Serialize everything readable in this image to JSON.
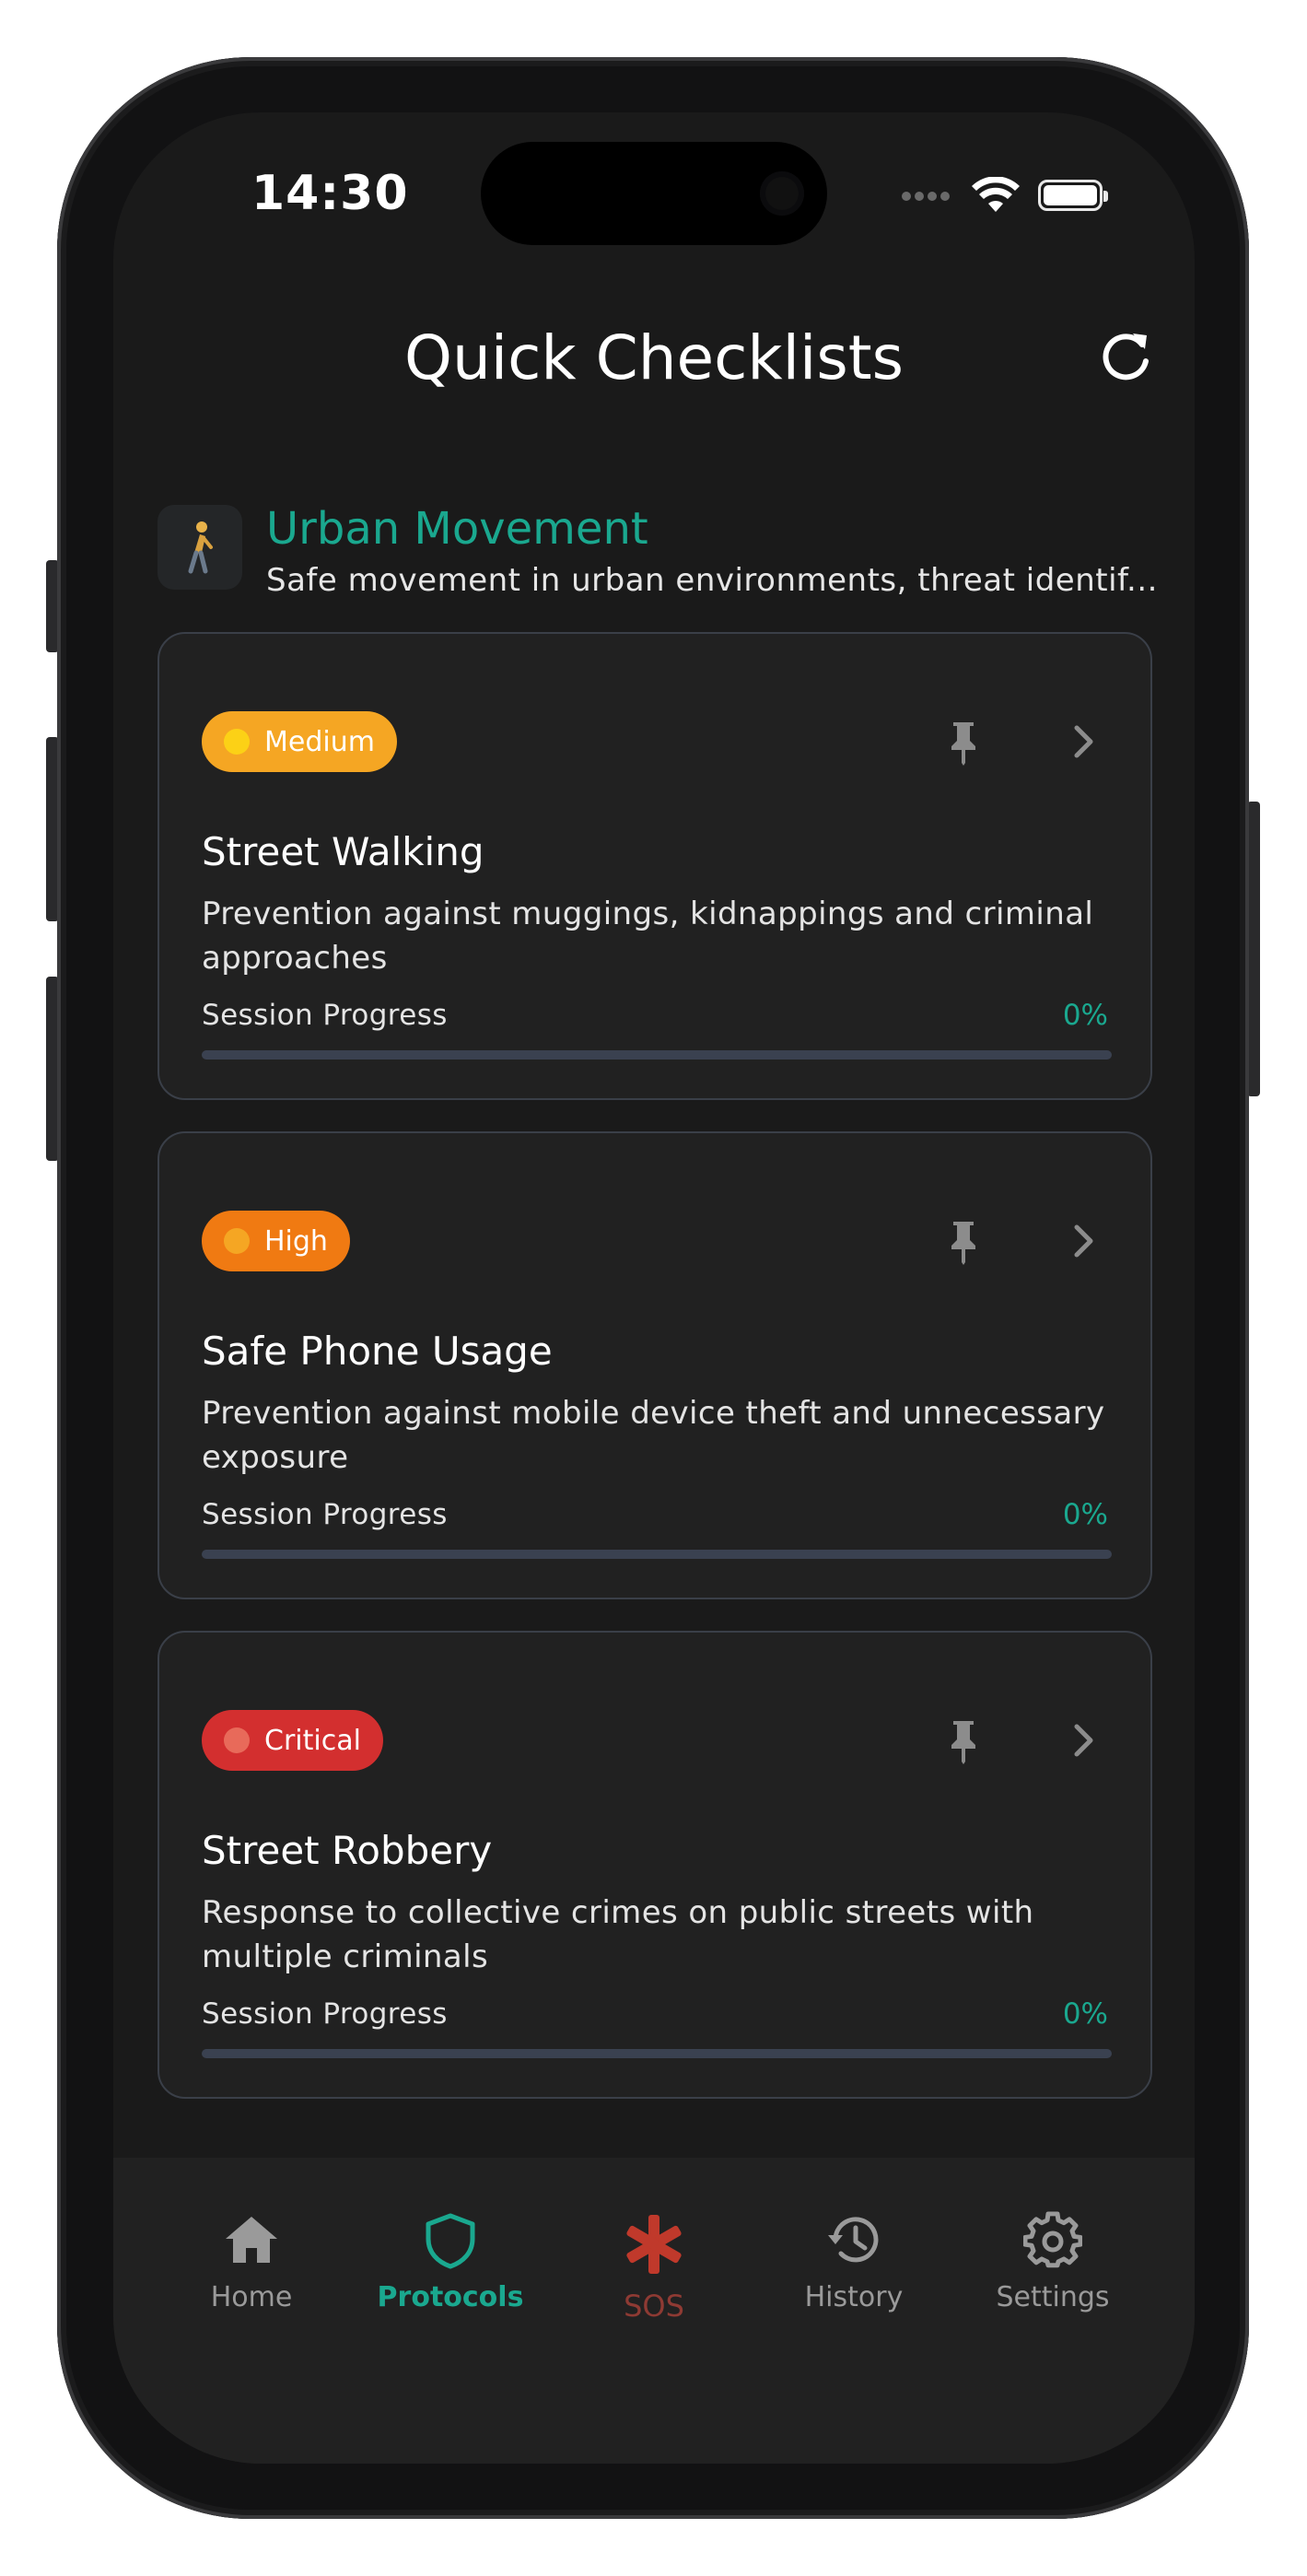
{
  "status_bar": {
    "time": "14:30"
  },
  "header": {
    "title": "Quick Checklists",
    "refresh_icon": "refresh-icon"
  },
  "section": {
    "icon": "walking-person-icon",
    "title": "Urban Movement",
    "subtitle": "Safe movement in urban environments, threat identif..."
  },
  "cards": [
    {
      "badge": "Medium",
      "badge_color": "#f5a623",
      "dot_color": "#fcd116",
      "title": "Street Walking",
      "description": "Prevention against muggings, kidnappings and criminal approaches",
      "progress_label": "Session Progress",
      "progress_text": "0%",
      "progress": 0
    },
    {
      "badge": "High",
      "badge_color": "#f07a12",
      "dot_color": "#f5a623",
      "title": "Safe Phone Usage",
      "description": "Prevention against mobile device theft and unnecessary exposure",
      "progress_label": "Session Progress",
      "progress_text": "0%",
      "progress": 0
    },
    {
      "badge": "Critical",
      "badge_color": "#d32f2f",
      "dot_color": "#e86a5a",
      "title": "Street Robbery",
      "description": "Response to collective crimes on public streets with multiple criminals",
      "progress_label": "Session Progress",
      "progress_text": "0%",
      "progress": 0
    }
  ],
  "nav": {
    "items": [
      {
        "label": "Home",
        "icon": "home-icon"
      },
      {
        "label": "Protocols",
        "icon": "shield-icon",
        "active": true
      },
      {
        "label": "SOS",
        "icon": "sos-asterisk-icon"
      },
      {
        "label": "History",
        "icon": "history-icon"
      },
      {
        "label": "Settings",
        "icon": "gear-icon"
      }
    ]
  },
  "colors": {
    "accent": "#1aa88f",
    "sos": "#c0392b",
    "background": "#1a1a1a",
    "card": "#212121"
  }
}
